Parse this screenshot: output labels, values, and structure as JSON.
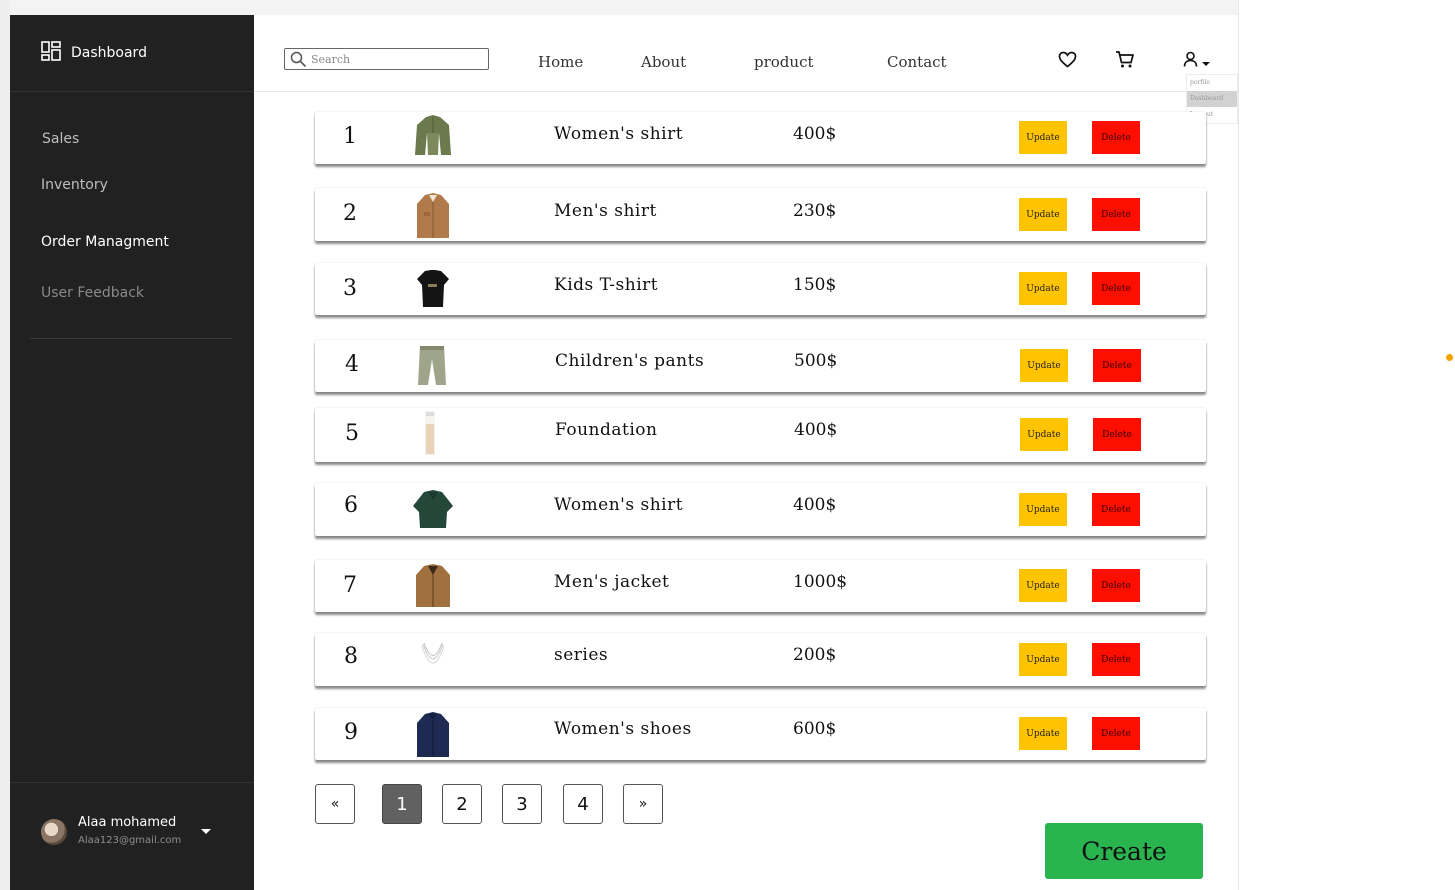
{
  "sidebar": {
    "title": "Dashboard",
    "items": [
      {
        "label": "Sales",
        "color": "#bdbdbd"
      },
      {
        "label": "Inventory",
        "color": "#bdbdbd"
      },
      {
        "label": "Order Managment",
        "color": "#ffffff"
      },
      {
        "label": "User Feedback",
        "color": "#8a8a8a"
      }
    ],
    "user": {
      "name": "Alaa mohamed",
      "email": "Alaa123@gmail.com"
    }
  },
  "topnav": {
    "search_placeholder": "Search",
    "links": [
      "Home",
      "About",
      "product",
      "Contact"
    ],
    "icons": [
      "heart-icon",
      "cart-icon",
      "user-icon"
    ],
    "user_menu": [
      "porfile",
      "Dashboard",
      "Log out"
    ],
    "user_menu_active": "Dashboard"
  },
  "products": [
    {
      "num": "1",
      "name": "Women's shirt",
      "price": "400$",
      "image": "olive-shirt"
    },
    {
      "num": "2",
      "name": "Men's shirt",
      "price": "230$",
      "image": "tan-shirt"
    },
    {
      "num": "3",
      "name": "Kids T-shirt",
      "price": "150$",
      "image": "black-tshirt"
    },
    {
      "num": "4",
      "name": "Children's pants",
      "price": "500$",
      "image": "green-pants"
    },
    {
      "num": "5",
      "name": "Foundation",
      "price": "400$",
      "image": "foundation-bottle"
    },
    {
      "num": "6",
      "name": "Women's shirt",
      "price": "400$",
      "image": "green-shirt"
    },
    {
      "num": "7",
      "name": "Men's jacket",
      "price": "1000$",
      "image": "brown-jacket"
    },
    {
      "num": "8",
      "name": "series",
      "price": "200$",
      "image": "necklace"
    },
    {
      "num": "9",
      "name": "Women's shoes",
      "price": "600$",
      "image": "navy-shirt"
    }
  ],
  "actions": {
    "update": "Update",
    "delete": "Delete"
  },
  "pagination": {
    "prev": "«",
    "pages": [
      "1",
      "2",
      "3",
      "4"
    ],
    "next": "»",
    "current": "1"
  },
  "create_label": "Create",
  "colors": {
    "sidebar": "#212121",
    "update": "#fec400",
    "delete": "#fd0f00",
    "create": "#2ab44f",
    "page_active": "#616161"
  }
}
